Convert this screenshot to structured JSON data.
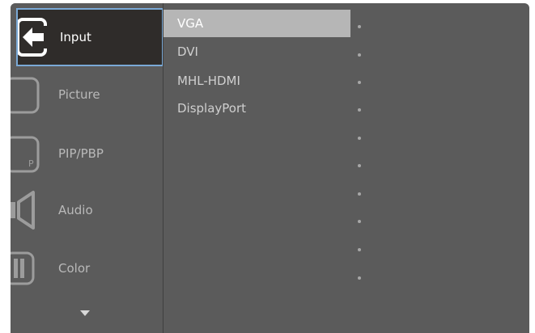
{
  "menu": {
    "items": [
      {
        "label": "Input",
        "icon": "input-icon",
        "active": true
      },
      {
        "label": "Picture",
        "icon": "picture-icon",
        "active": false
      },
      {
        "label": "PIP/PBP",
        "icon": "pip-pbp-icon",
        "active": false,
        "icon_text": "P"
      },
      {
        "label": "Audio",
        "icon": "audio-icon",
        "active": false
      },
      {
        "label": "Color",
        "icon": "color-icon",
        "active": false
      }
    ],
    "more_indicator": "chevron-down-icon"
  },
  "submenu": {
    "items": [
      {
        "label": "VGA",
        "active": true
      },
      {
        "label": "DVI",
        "active": false
      },
      {
        "label": "MHL-HDMI",
        "active": false
      },
      {
        "label": "DisplayPort",
        "active": false
      }
    ]
  },
  "colors": {
    "active_border": "#7aa9d6",
    "background": "#5b5b5b",
    "active_bg": "#2f2c2a"
  }
}
